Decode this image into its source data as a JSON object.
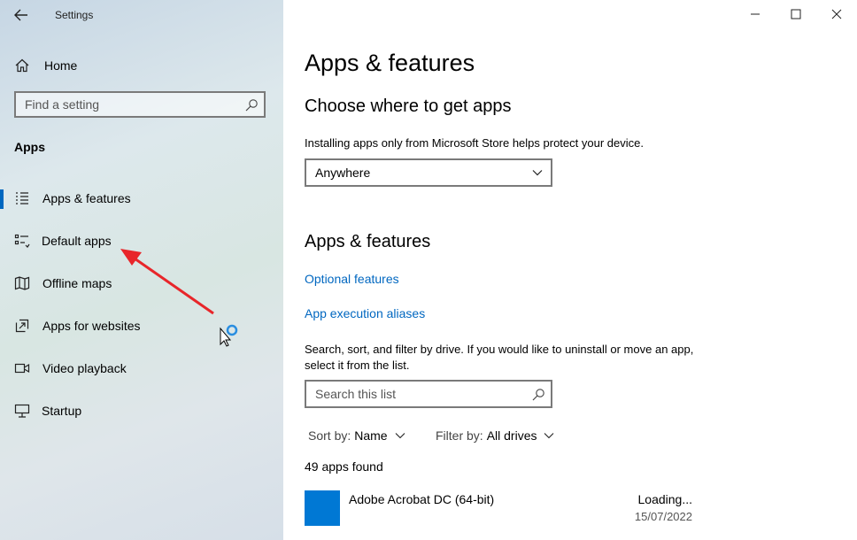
{
  "window": {
    "title": "Settings",
    "controls": [
      "minimize",
      "maximize",
      "close"
    ]
  },
  "sidebar": {
    "home_label": "Home",
    "search_placeholder": "Find a setting",
    "section_label": "Apps",
    "items": [
      {
        "label": "Apps & features",
        "icon": "apps-features-icon",
        "active": true
      },
      {
        "label": "Default apps",
        "icon": "default-apps-icon",
        "active": false
      },
      {
        "label": "Offline maps",
        "icon": "map-icon",
        "active": false
      },
      {
        "label": "Apps for websites",
        "icon": "open-in-icon",
        "active": false
      },
      {
        "label": "Video playback",
        "icon": "video-icon",
        "active": false
      },
      {
        "label": "Startup",
        "icon": "startup-icon",
        "active": false
      }
    ]
  },
  "main": {
    "title": "Apps & features",
    "choose_heading": "Choose where to get apps",
    "choose_desc": "Installing apps only from Microsoft Store helps protect your device.",
    "source_dropdown": {
      "value": "Anywhere"
    },
    "apps_heading": "Apps & features",
    "links": {
      "optional_features": "Optional features",
      "app_execution_aliases": "App execution aliases"
    },
    "search_desc": "Search, sort, and filter by drive. If you would like to uninstall or move an app, select it from the list.",
    "list_search_placeholder": "Search this list",
    "sort": {
      "label": "Sort by:",
      "value": "Name"
    },
    "filter": {
      "label": "Filter by:",
      "value": "All drives"
    },
    "apps_found": "49 apps found",
    "apps": [
      {
        "name": "Adobe Acrobat DC (64-bit)",
        "size": "Loading...",
        "date": "15/07/2022"
      }
    ]
  },
  "colors": {
    "accent": "#0067c0",
    "app_tile": "#0078d4",
    "annotation_arrow": "#e8262a"
  }
}
